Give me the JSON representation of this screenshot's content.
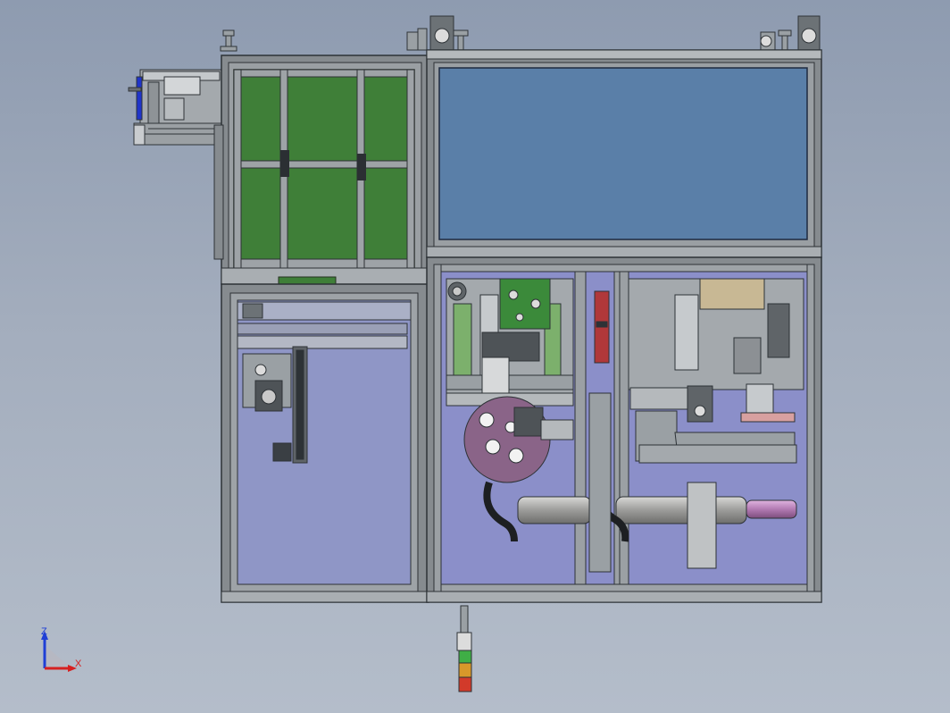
{
  "view": {
    "background_top": "#8e9bb0",
    "background_bottom": "#b4bdca"
  },
  "colors": {
    "frame": "#7c8286",
    "frame_dark": "#3a3f44",
    "green_panel": "#3f7f38",
    "blue_panel": "#5a7fa8",
    "glass_left": "#8f96c6",
    "glass_right": "#8b8fc9",
    "pcb_green": "#3b8a3a",
    "wheel": "#8a6488",
    "tower_red": "#d23a2a",
    "tower_orange": "#d8982a",
    "tower_green": "#3fae46"
  },
  "triad": {
    "z_label": "Z",
    "x_label": "X",
    "z_color": "#1f3fd6",
    "x_color": "#d62020"
  }
}
